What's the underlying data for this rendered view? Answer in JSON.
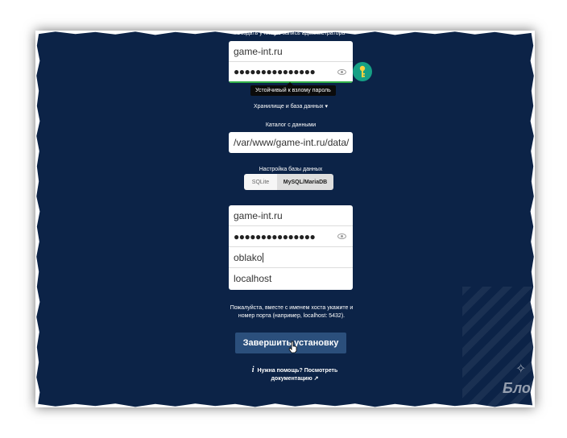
{
  "header": {
    "create_admin": "Создать учетную запись администратора"
  },
  "admin": {
    "username": "game-int.ru",
    "password_mask": "●●●●●●●●●●●●●●●",
    "strength_tooltip": "Устойчивый к взлому пароль"
  },
  "storage": {
    "toggle_label": "Хранилище и база данных",
    "data_dir_label": "Каталог с данными",
    "data_dir_value": "/var/www/game-int.ru/data/"
  },
  "db": {
    "config_label": "Настройка базы данных",
    "options": [
      "SQLite",
      "MySQL/MariaDB"
    ],
    "selected": "MySQL/MariaDB",
    "user": "game-int.ru",
    "password_mask": "●●●●●●●●●●●●●●●",
    "name": "oblako",
    "host": "localhost",
    "hint": "Пожалуйста, вместе с именем хоста укажите и номер порта (например, localhost: 5432)."
  },
  "actions": {
    "finish": "Завершить установку"
  },
  "help": {
    "text": "Нужна помощь? Посмотреть",
    "link": "документацию ↗"
  },
  "watermark": {
    "brand": "Бло"
  },
  "colors": {
    "background": "#0c2347",
    "button": "#2b4f7c",
    "key_badge": "#16a085",
    "strength_bar": "#34b34a"
  }
}
